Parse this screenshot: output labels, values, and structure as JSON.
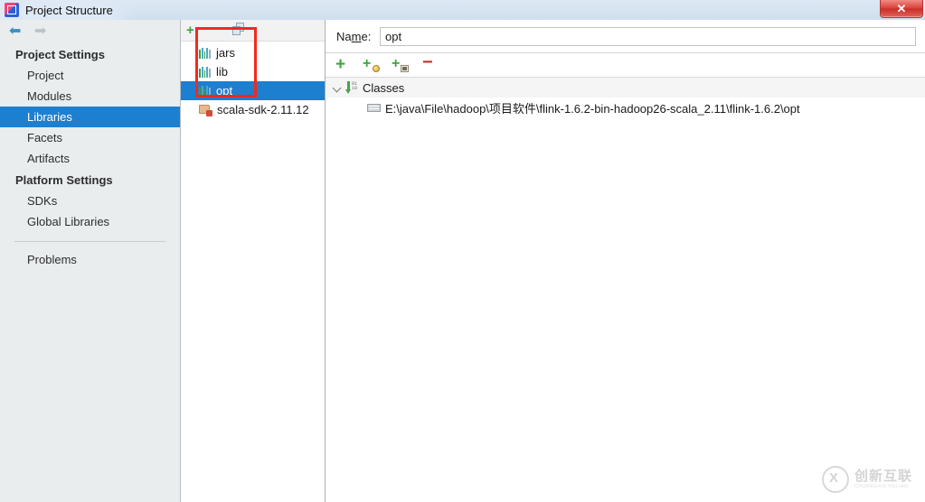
{
  "window": {
    "title": "Project Structure",
    "app_icon": "intellij-idea-icon",
    "close_label": "✕"
  },
  "nav": {
    "back_icon": "arrow-left-icon",
    "back_glyph": "⬅",
    "forward_icon": "arrow-right-icon",
    "forward_glyph": "➡"
  },
  "sidebar": {
    "groups": [
      {
        "label": "Project Settings",
        "items": [
          {
            "label": "Project",
            "selected": false
          },
          {
            "label": "Modules",
            "selected": false
          },
          {
            "label": "Libraries",
            "selected": true
          },
          {
            "label": "Facets",
            "selected": false
          },
          {
            "label": "Artifacts",
            "selected": false
          }
        ]
      },
      {
        "label": "Platform Settings",
        "items": [
          {
            "label": "SDKs",
            "selected": false
          },
          {
            "label": "Global Libraries",
            "selected": false
          }
        ]
      }
    ],
    "footer_items": [
      {
        "label": "Problems",
        "selected": false
      }
    ]
  },
  "libraries_panel": {
    "toolbar": {
      "add_icon": "plus-icon",
      "add_glyph": "+",
      "copy_icon": "copy-icon"
    },
    "items": [
      {
        "label": "jars",
        "icon": "library-icon",
        "selected": false
      },
      {
        "label": "lib",
        "icon": "library-icon",
        "selected": false
      },
      {
        "label": "opt",
        "icon": "library-icon",
        "selected": true
      },
      {
        "label": "scala-sdk-2.11.12",
        "icon": "scala-sdk-icon",
        "selected": false
      }
    ],
    "annotation": {
      "shape": "rectangle",
      "color": "#f2291d"
    }
  },
  "details": {
    "name_label_pre": "Na",
    "name_label_mnemonic": "m",
    "name_label_post": "e:",
    "name_value": "opt",
    "name_placeholder": "",
    "toolbar": [
      {
        "name": "add-root-button",
        "glyph": "+",
        "icon": "plus-icon"
      },
      {
        "name": "add-url-root-button",
        "glyph": "+",
        "icon": "plus-globe-icon"
      },
      {
        "name": "add-jar-directory-button",
        "glyph": "+",
        "icon": "plus-box-icon"
      },
      {
        "name": "remove-root-button",
        "glyph": "−",
        "icon": "minus-icon"
      }
    ],
    "tree": {
      "group_label": "Classes",
      "group_icon": "classes-down-arrow-icon",
      "expanded": true,
      "children": [
        {
          "label": "E:\\java\\File\\hadoop\\项目软件\\flink-1.6.2-bin-hadoop26-scala_2.11\\flink-1.6.2\\opt",
          "icon": "folder-icon"
        }
      ]
    }
  },
  "watermark": {
    "cn": "创新互联",
    "en": "CHUANGXIN HULIAN",
    "mark": "cx-logo-icon"
  },
  "colors": {
    "selection_blue": "#1d7fd0",
    "annotation_red": "#f2291d",
    "titlebar_blue": "#dde8f4",
    "sidebar_bg": "#e9edee",
    "close_red": "#d9413a"
  }
}
